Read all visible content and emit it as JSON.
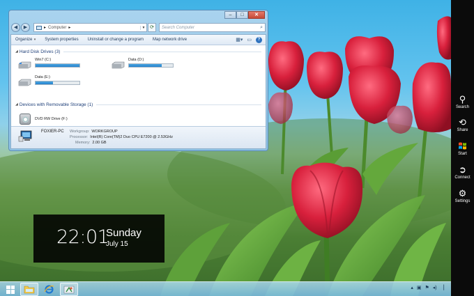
{
  "window": {
    "address": {
      "root": "Computer"
    },
    "search_placeholder": "Search Computer",
    "caption": {
      "minimize": "–",
      "maximize": "□",
      "close": "✕"
    },
    "toolbar": [
      "Organize",
      "System properties",
      "Uninstall or change a program",
      "Map network drive"
    ],
    "hard_disk_group": "Hard Disk Drives (3)",
    "drives": [
      {
        "name": "Win7 (C:)",
        "used_percent": 100
      },
      {
        "name": "Data (D:)",
        "used_percent": 75
      },
      {
        "name": "Data (E:)",
        "used_percent": 40
      }
    ],
    "removable_group": "Devices with Removable Storage (1)",
    "dvd": "DVD RW Drive (F:)",
    "details": {
      "pc_name": "FOXIER-PC",
      "workgroup_label": "Workgroup:",
      "workgroup": "WORKGROUP",
      "processor_label": "Processor:",
      "processor": "Intel(R) Core(TM)2 Duo CPU     E7200  @ 2.53GHz",
      "memory_label": "Memory:",
      "memory": "2.00 GB"
    }
  },
  "clock": {
    "time": "22:01",
    "day": "Sunday",
    "date": "July 15"
  },
  "charms": [
    {
      "icon": "search-icon",
      "label": "Search"
    },
    {
      "icon": "share-icon",
      "label": "Share"
    },
    {
      "icon": "windows-logo-icon",
      "label": "Start"
    },
    {
      "icon": "connect-icon",
      "label": "Connect"
    },
    {
      "icon": "gear-icon",
      "label": "Settings"
    }
  ],
  "taskbar": {
    "items": [
      "start-button",
      "file-explorer",
      "internet-explorer",
      "control-panel"
    ]
  },
  "colors": {
    "charms_bg": "#0b0b0b",
    "window_frame": "#a9d3ee",
    "progress_fill": "#2582cc",
    "clock_bg": "#000000"
  }
}
